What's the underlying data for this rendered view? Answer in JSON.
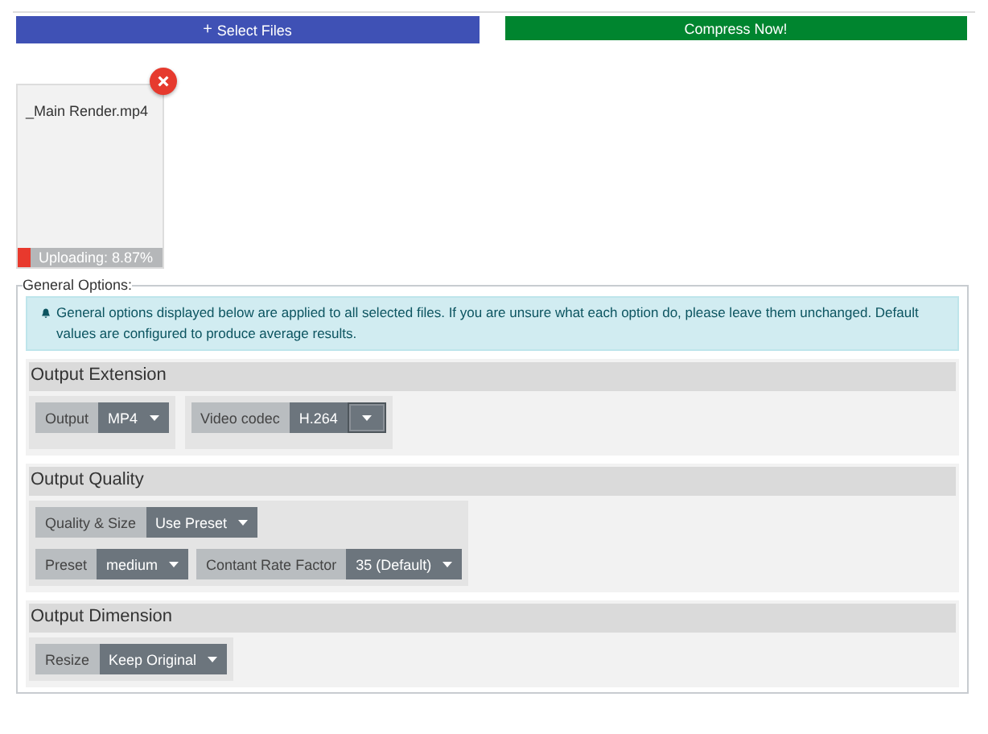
{
  "actions": [
    {
      "label": "Select Files",
      "icon": "+",
      "kind": "primary"
    },
    {
      "label": "Compress Now!",
      "kind": "success"
    }
  ],
  "files": [
    {
      "name": "_Main Render.mp4",
      "status": "Uploading: 8.87%",
      "level": 0.0887
    }
  ],
  "options": {
    "legend": "General Options:",
    "alert": "General options displayed below are applied to all selected files. If you are unsure what each option do, please leave them unchanged. Default values are configured to produce average results.",
    "sections": [
      {
        "title": "Output Extension",
        "groups": [
          {
            "rows": [
              [
                {
                  "label": "Output",
                  "value": "MP4",
                  "kind": "dropdown"
                }
              ]
            ]
          },
          {
            "rows": [
              [
                {
                  "label": "Video codec",
                  "value": "H.264",
                  "kind": "split"
                }
              ]
            ]
          }
        ]
      },
      {
        "title": "Output Quality",
        "groups": [
          {
            "rows": [
              [
                {
                  "label": "Quality & Size",
                  "value": "Use Preset",
                  "kind": "dropdown"
                }
              ],
              [
                {
                  "label": "Preset",
                  "value": "medium",
                  "kind": "dropdown"
                },
                {
                  "label": "Contant Rate Factor",
                  "value": "35 (Default)",
                  "kind": "dropdown"
                }
              ]
            ]
          }
        ]
      },
      {
        "title": "Output Dimension",
        "groups": [
          {
            "rows": [
              [
                {
                  "label": "Resize",
                  "value": "Keep Original",
                  "kind": "dropdown"
                }
              ]
            ]
          }
        ]
      }
    ]
  }
}
